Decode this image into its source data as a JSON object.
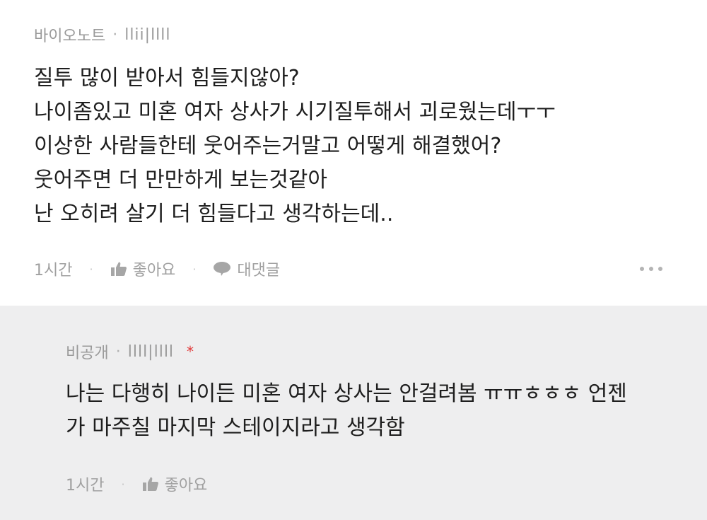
{
  "comment": {
    "author": "바이오노트",
    "separator": "·",
    "author_id": "llii|llll",
    "lines": [
      "질투 많이 받아서 힘들지않아?",
      "나이좀있고 미혼 여자 상사가 시기질투해서 괴로웠는데ㅜㅜ",
      "이상한 사람들한테 웃어주는거말고 어떻게 해결했어?",
      "웃어주면 더 만만하게 보는것같아",
      "난 오히려 살기 더 힘들다고 생각하는데.."
    ],
    "time": "1시간",
    "like_label": "좋아요",
    "reply_label": "대댓글",
    "icons": {
      "like": "thumbs-up-icon",
      "reply": "speech-bubble-icon",
      "more": "more-dots-icon"
    }
  },
  "reply": {
    "author": "비공개",
    "separator": "·",
    "author_id": "llll|llll",
    "secret_mark": "*",
    "lines": [
      "나는 다행히 나이든 미혼 여자 상사는 안걸려봄 ㅠㅠㅎㅎㅎ 언젠",
      "가 마주칠 마지막 스테이지라고 생각함"
    ],
    "time": "1시간",
    "like_label": "좋아요",
    "icons": {
      "like": "thumbs-up-icon"
    }
  },
  "colors": {
    "reply_background": "#eeeeef",
    "secret_mark": "#e03a3a",
    "meta_text": "#9a9a9a",
    "body_text": "#1e1e1e"
  }
}
